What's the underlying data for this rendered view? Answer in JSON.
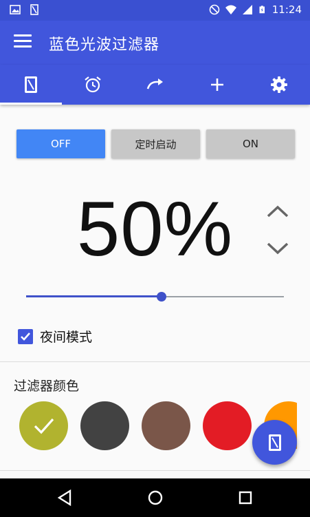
{
  "status_bar": {
    "time": "11:24",
    "left_icons": [
      "image-notification-icon",
      "filter-notification-icon"
    ],
    "right_icons": [
      "do-not-disturb-icon",
      "wifi-icon",
      "signal-icon",
      "battery-charging-icon"
    ]
  },
  "app_bar": {
    "title": "蓝色光波过滤器",
    "menu_icon": "menu-icon"
  },
  "tabs": [
    {
      "icon": "filter-phone-icon",
      "active": true
    },
    {
      "icon": "alarm-clock-icon",
      "active": false
    },
    {
      "icon": "redo-arrow-icon",
      "active": false
    },
    {
      "icon": "plus-icon",
      "active": false
    },
    {
      "icon": "gear-icon",
      "active": false
    }
  ],
  "mode_buttons": {
    "off_label": "OFF",
    "timer_label": "定时启动",
    "on_label": "ON",
    "selected": "OFF"
  },
  "intensity": {
    "value_text": "50%",
    "fraction": 0.525
  },
  "night_mode": {
    "label": "夜间模式",
    "checked": true
  },
  "filter_colors": {
    "title": "过滤器颜色",
    "swatches": [
      {
        "color": "#b1b32f",
        "selected": true
      },
      {
        "color": "#424242",
        "selected": false
      },
      {
        "color": "#7a5649",
        "selected": false
      },
      {
        "color": "#e31c25",
        "selected": false
      },
      {
        "color": "#ff9800",
        "selected": false
      }
    ]
  },
  "colors": {
    "primary": "#4156dc",
    "accent_button": "#4286f5"
  }
}
